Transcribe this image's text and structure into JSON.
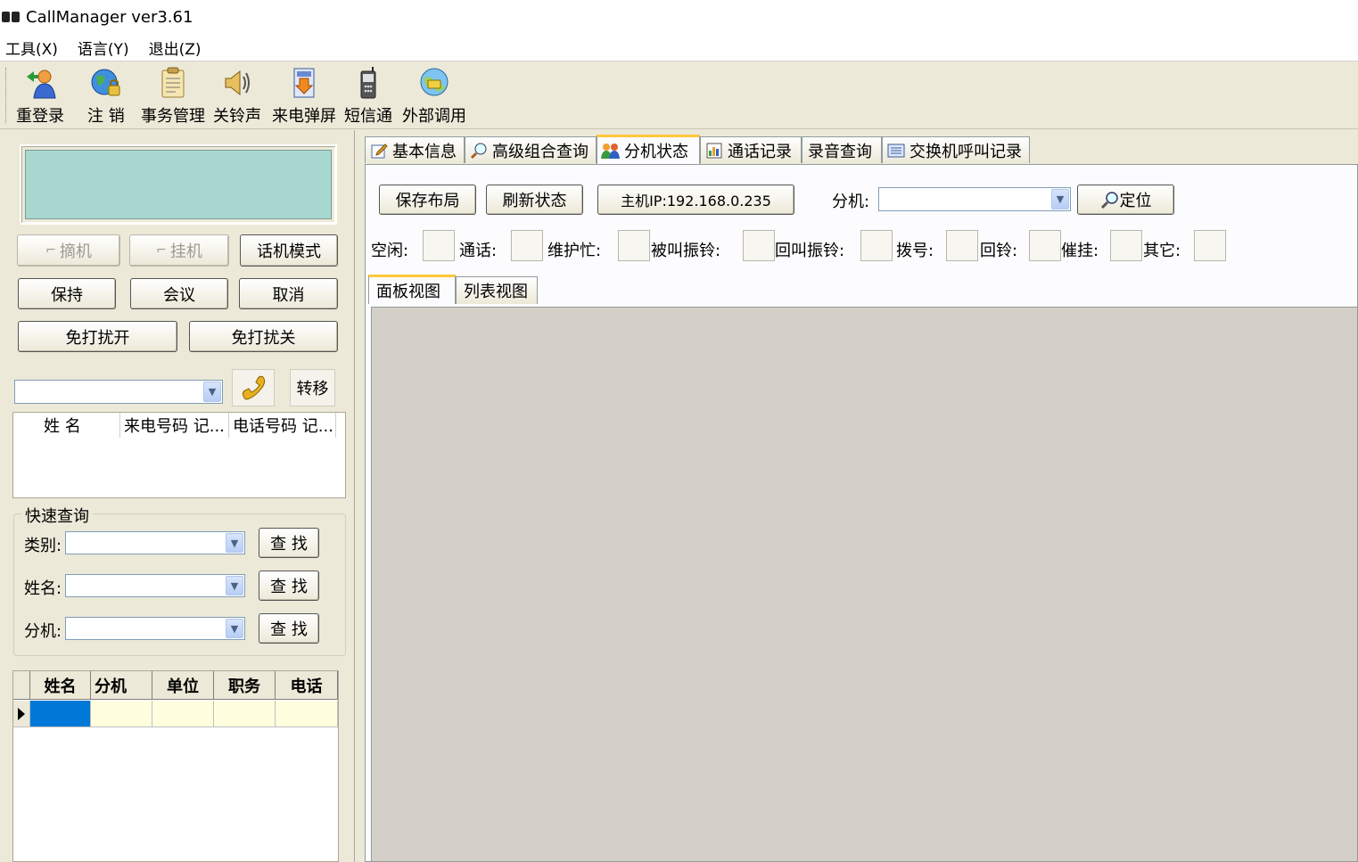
{
  "window": {
    "title": "CallManager ver3.61"
  },
  "menu": {
    "items": [
      "工具(X)",
      "语言(Y)",
      "退出(Z)"
    ]
  },
  "toolbar": {
    "buttons": [
      {
        "label": "重登录",
        "icon": "relogin-user-icon"
      },
      {
        "label": "注 销",
        "icon": "globe-logout-icon"
      },
      {
        "label": "事务管理",
        "icon": "clipboard-icon"
      },
      {
        "label": "关铃声",
        "icon": "speaker-icon"
      },
      {
        "label": "来电弹屏",
        "icon": "download-popup-icon"
      },
      {
        "label": "短信通",
        "icon": "mobile-phone-icon"
      },
      {
        "label": "外部调用",
        "icon": "network-globe-icon"
      }
    ]
  },
  "phone": {
    "pickup_label": "摘机",
    "hangup_label": "挂机",
    "mode_label": "话机模式",
    "hold_label": "保持",
    "conference_label": "会议",
    "cancel_label": "取消",
    "dnd_on_label": "免打扰开",
    "dnd_off_label": "免打扰关",
    "transfer_label": "转移",
    "call_log_columns": [
      "姓 名",
      "来电号码 记...",
      "电话号码 记..."
    ]
  },
  "quick_search": {
    "title": "快速查询",
    "fields": [
      {
        "label": "类别:",
        "button": "查 找"
      },
      {
        "label": "姓名:",
        "button": "查 找"
      },
      {
        "label": "分机:",
        "button": "查 找"
      }
    ]
  },
  "contacts_grid": {
    "columns": [
      "姓名",
      "分机",
      "单位",
      "职务",
      "电话"
    ]
  },
  "tabs": [
    {
      "label": "基本信息",
      "icon": "edit-info-icon"
    },
    {
      "label": "高级组合查询",
      "icon": "magnifier-icon"
    },
    {
      "label": "分机状态",
      "icon": "users-icon"
    },
    {
      "label": "通话记录",
      "icon": "call-record-icon"
    },
    {
      "label": "录音查询",
      "icon": ""
    },
    {
      "label": "交换机呼叫记录",
      "icon": "switch-log-icon"
    }
  ],
  "extension_status": {
    "save_layout_label": "保存布局",
    "refresh_label": "刷新状态",
    "host_ip_label": "主机IP:192.168.0.235",
    "extension_label": "分机:",
    "locate_label": "定位",
    "status_legend": [
      "空闲:",
      "通话:",
      "维护忙:",
      "被叫振铃:",
      "回叫振铃:",
      "拨号:",
      "回铃:",
      "催挂:",
      "其它:"
    ],
    "views": [
      "面板视图",
      "列表视图"
    ]
  },
  "colors": {
    "lcd": "#a8d7cf",
    "selected_cell": "#0078d7",
    "grid_row": "#ffffe0",
    "active_tab_accent": "#ffc83c"
  }
}
